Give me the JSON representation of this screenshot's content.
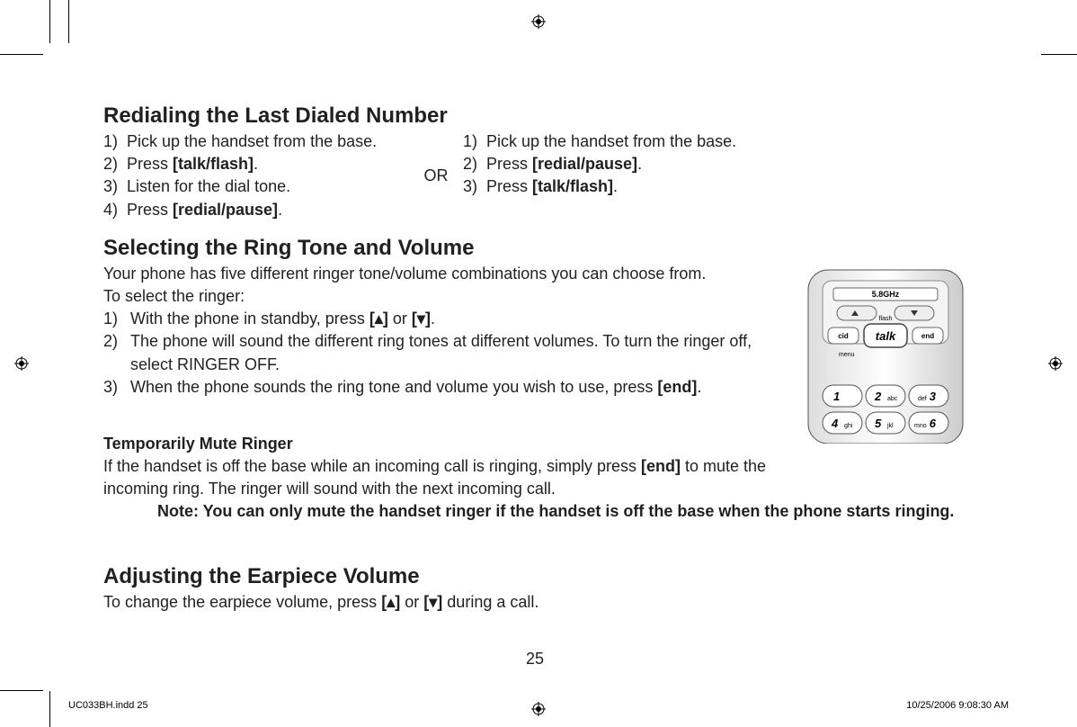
{
  "headings": {
    "redial": "Redialing the Last Dialed Number",
    "ringtone": "Selecting the Ring Tone and Volume",
    "mute": "Temporarily Mute Ringer",
    "earpiece": "Adjusting the Earpiece Volume"
  },
  "redial": {
    "left": [
      {
        "num": "1)",
        "pre": "Pick up the handset from the base."
      },
      {
        "num": "2)",
        "pre": "Press ",
        "bold": "[talk/flash]",
        "post": "."
      },
      {
        "num": "3)",
        "pre": "Listen for the dial tone."
      },
      {
        "num": "4)",
        "pre": "Press ",
        "bold": "[redial/pause]",
        "post": "."
      }
    ],
    "or": "OR",
    "right": [
      {
        "num": "1)",
        "pre": "Pick up the handset from the base."
      },
      {
        "num": "2)",
        "pre": "Press ",
        "bold": "[redial/pause]",
        "post": "."
      },
      {
        "num": "3)",
        "pre": "Press ",
        "bold": "[talk/flash]",
        "post": "."
      }
    ]
  },
  "ringtone": {
    "intro1": "Your phone has five different ringer tone/volume combinations you can choose from.",
    "intro2": "To select the ringer:",
    "steps": [
      {
        "num": "1)",
        "parts": [
          "With the phone in standby, press ",
          "[",
          "▴",
          "]",
          " or ",
          "[",
          "▾",
          "]",
          "."
        ]
      },
      {
        "num": "2)",
        "pre": "The phone will sound the different ring tones at different volumes. To turn the ringer off, select RINGER OFF."
      },
      {
        "num": "3)",
        "pre": "When the phone sounds the ring tone and volume you wish to use, press ",
        "bold": "[end]",
        "post": "."
      }
    ]
  },
  "mute": {
    "line_pre": "If the handset is off the base while an incoming call is ringing, simply press ",
    "line_bold": "[end]",
    "line_post": " to mute the incoming ring. The ringer will sound with the next incoming call.",
    "note": "Note: You can only mute the handset ringer if the handset is off the base when the phone starts ringing."
  },
  "earpiece": {
    "parts": [
      "To change the earpiece volume, press ",
      "[",
      "▴",
      "]",
      " or ",
      "[",
      "▾",
      "]",
      " during a call."
    ]
  },
  "pagenum": "25",
  "footer": {
    "left": "UC033BH.indd   25",
    "right": "10/25/2006   9:08:30 AM"
  },
  "phone_labels": {
    "freq": "5.8GHz",
    "flash": "flash",
    "cid": "cid",
    "talk": "talk",
    "end": "end",
    "menu": "menu",
    "k1": "1",
    "k2": "2",
    "k2s": "abc",
    "k3": "3",
    "k3s": "def",
    "k4": "4",
    "k4s": "ghi",
    "k5": "5",
    "k5s": "jkl",
    "k6": "6",
    "k6s": "mno"
  }
}
